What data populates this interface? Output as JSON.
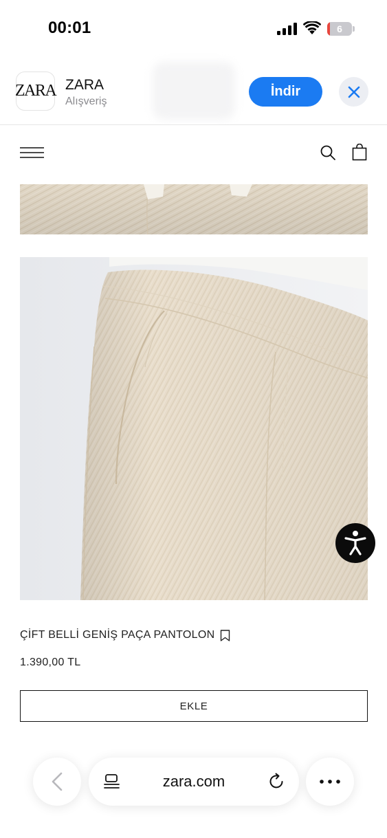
{
  "status_bar": {
    "time": "00:01",
    "battery_level": "6",
    "battery_fraction": 0.06
  },
  "app_banner": {
    "icon_text": "ZARA",
    "app_name": "ZARA",
    "category": "Alışveriş",
    "download_label": "İndir",
    "accent_color": "#1b7bf2"
  },
  "header": {
    "icons": [
      "menu-icon",
      "search-icon",
      "shopping-bag-icon"
    ]
  },
  "product": {
    "name": "ÇİFT BELLİ GENİŞ PAÇA PANTOLON",
    "price": "1.390,00 TL",
    "add_label": "EKLE",
    "fabric_color": "#e8ddcb"
  },
  "browser": {
    "url": "zara.com",
    "icons": [
      "back-icon",
      "reader-icon",
      "reload-icon",
      "more-icon"
    ]
  }
}
